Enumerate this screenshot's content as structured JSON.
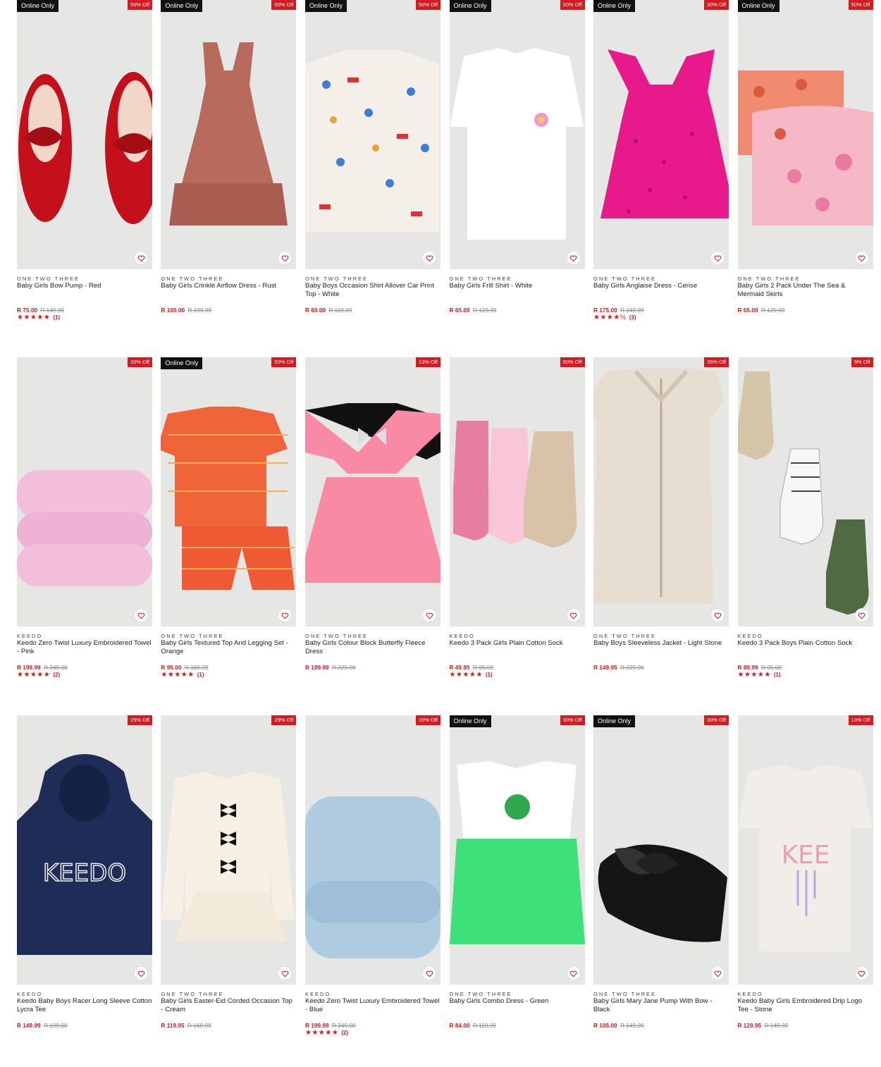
{
  "badges": {
    "online": "Online Only"
  },
  "colors": {
    "accent": "#d71920",
    "tile": "#e6e6e4"
  },
  "icons": {
    "wishlist": "heart-outline-icon",
    "star": "star-icon"
  },
  "products": [
    {
      "brand": "ONE TWO THREE",
      "name": "Baby Girls Bow Pump - Red",
      "price": "R 75.00",
      "was": "R 149.99",
      "discount": "50% Off",
      "online_only": true,
      "stars": "★★★★★",
      "reviews": "(1)",
      "image": "red-bow-pump"
    },
    {
      "brand": "ONE TWO THREE",
      "name": "Baby Girls Crinkle Airflow Dress - Rust",
      "price": "R 100.00",
      "was": "R 199.99",
      "discount": "50% Off",
      "online_only": true,
      "stars": "",
      "reviews": "",
      "image": "rust-dress"
    },
    {
      "brand": "ONE TWO THREE",
      "name": "Baby Boys Occasion Shirt Allover Car Print Top - White",
      "price": "R 60.00",
      "was": "R 119.99",
      "discount": "50% Off",
      "online_only": true,
      "stars": "",
      "reviews": "",
      "image": "car-print-shirt"
    },
    {
      "brand": "ONE TWO THREE",
      "name": "Baby Girls Frill Shirt - White",
      "price": "R 65.00",
      "was": "R 129.99",
      "discount": "50% Off",
      "online_only": true,
      "stars": "",
      "reviews": "",
      "image": "white-frill-shirt"
    },
    {
      "brand": "ONE TWO THREE",
      "name": "Baby Girls Anglaise Dress - Cerise",
      "price": "R 175.00",
      "was": "R 249.99",
      "discount": "30% Off",
      "online_only": true,
      "stars": "★★★★½",
      "reviews": "(3)",
      "image": "cerise-dress"
    },
    {
      "brand": "ONE TWO THREE",
      "name": "Baby Girls 2 Pack Under The Sea & Mermaid Skirts",
      "price": "R 65.00",
      "was": "R 129.99",
      "discount": "50% Off",
      "online_only": true,
      "stars": "",
      "reviews": "",
      "image": "mermaid-skirts"
    },
    {
      "brand": "KEEDO",
      "name": "Keedo Zero Twist Luxury Embroidered Towel - Pink",
      "price": "R 199.99",
      "was": "R 249.00",
      "discount": "20% Off",
      "online_only": false,
      "stars": "★★★★★",
      "reviews": "(2)",
      "image": "pink-towel"
    },
    {
      "brand": "ONE TWO THREE",
      "name": "Baby Girls Textured Top And Legging Set - Orange",
      "price": "R 95.00",
      "was": "R 189.99",
      "discount": "50% Off",
      "online_only": true,
      "stars": "★★★★★",
      "reviews": "(1)",
      "image": "orange-set"
    },
    {
      "brand": "ONE TWO THREE",
      "name": "Baby Girls Colour Block Butterfly Fleece Dress",
      "price": "R 199.99",
      "was": "R 229.99",
      "discount": "13% Off",
      "online_only": false,
      "stars": "",
      "reviews": "",
      "image": "butterfly-dress"
    },
    {
      "brand": "KEEDO",
      "name": "Keedo 3 Pack Girls Plain Cotton Sock",
      "price": "R 49.95",
      "was": "R 99.00",
      "discount": "50% Off",
      "online_only": false,
      "stars": "★★★★★",
      "reviews": "(1)",
      "image": "girls-socks"
    },
    {
      "brand": "ONE TWO THREE",
      "name": "Baby Boys Sleeveless Jacket - Light Stone",
      "price": "R 149.95",
      "was": "R 229.99",
      "discount": "35% Off",
      "online_only": false,
      "stars": "",
      "reviews": "",
      "image": "stone-vest"
    },
    {
      "brand": "KEEDO",
      "name": "Keedo 3 Pack Boys Plain Cotton Sock",
      "price": "R 89.99",
      "was": "R 99.00",
      "discount": "9% Off",
      "online_only": false,
      "stars": "★★★★★",
      "reviews": "(1)",
      "image": "boys-socks"
    },
    {
      "brand": "KEEDO",
      "name": "Keedo Baby Boys Racer Long Sleeve Cotton Lycra Tee",
      "price": "R 149.99",
      "was": "R 199.00",
      "discount": "25% Off",
      "online_only": false,
      "stars": "",
      "reviews": "",
      "image": "navy-hoodie"
    },
    {
      "brand": "ONE TWO THREE",
      "name": "Baby Girls Easter-Eid Corded Occasion Top - Cream",
      "price": "R 119.95",
      "was": "R 169.99",
      "discount": "29% Off",
      "online_only": false,
      "stars": "",
      "reviews": "",
      "image": "cream-top"
    },
    {
      "brand": "KEEDO",
      "name": "Keedo Zero Twist Luxury Embroidered Towel - Blue",
      "price": "R 199.99",
      "was": "R 249.00",
      "discount": "20% Off",
      "online_only": false,
      "stars": "★★★★★",
      "reviews": "(2)",
      "image": "blue-towel"
    },
    {
      "brand": "ONE TWO THREE",
      "name": "Baby Girls Combo Dress - Green",
      "price": "R 84.00",
      "was": "R 119.99",
      "discount": "30% Off",
      "online_only": true,
      "stars": "",
      "reviews": "",
      "image": "green-dress"
    },
    {
      "brand": "ONE TWO THREE",
      "name": "Baby Girls Mary Jane Pump With Bow - Black",
      "price": "R 105.00",
      "was": "R 149.99",
      "discount": "30% Off",
      "online_only": true,
      "stars": "",
      "reviews": "",
      "image": "black-pump"
    },
    {
      "brand": "KEEDO",
      "name": "Keedo Baby Girls Embroidered Drip Logo Tee - Stone",
      "price": "R 129.95",
      "was": "R 149.99",
      "discount": "13% Off",
      "online_only": false,
      "stars": "",
      "reviews": "",
      "image": "stone-tee"
    }
  ]
}
